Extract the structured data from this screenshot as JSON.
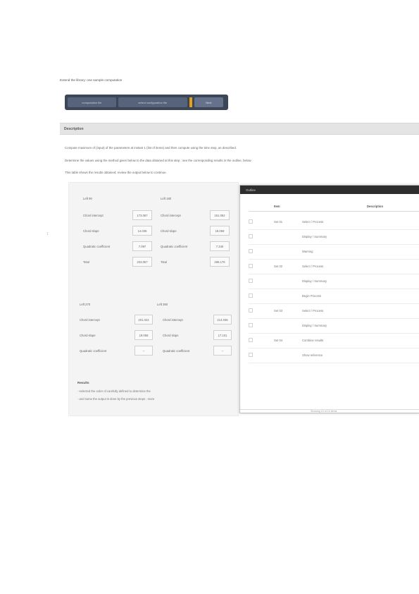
{
  "page": {
    "heading": "Extend the library: one sample computation"
  },
  "tabs": [
    "computation file",
    "select configuration file",
    "Next"
  ],
  "section": {
    "title": "Description",
    "lines": [
      "Compute maximum of (input) of the parameters at instant 1 (list of items) and then compute using the time step, as described.",
      "Determine the values using the method given below to the data obtained at this step ; see the corresponding results in the outline, below.",
      "This table shows the results obtained; review the output below to continue."
    ]
  },
  "table1": {
    "col_a": "Left 90",
    "col_b": "Left 180",
    "rows": [
      {
        "label_a": "Chord intercept",
        "val_a": "173.067",
        "label_b": "Chord intercept",
        "val_b": "151.062"
      },
      {
        "label_a": "Chord slope",
        "val_a": "14.035",
        "label_b": "Chord slope",
        "val_b": "18.059"
      },
      {
        "label_a": "Quadratic coefficient",
        "val_a": "7.097",
        "label_b": "Quadratic coefficient",
        "val_b": "7.340"
      },
      {
        "label_a": "Total",
        "val_a": "203.057",
        "label_b": "Total",
        "val_b": "286.176"
      }
    ]
  },
  "table2": {
    "col_a": "Left 270",
    "col_b": "Left 360",
    "rows": [
      {
        "label_a": "Chord intercept",
        "val_a": "201.022",
        "label_b": "Chord intercept",
        "val_b": "214.036"
      },
      {
        "label_a": "Chord slope",
        "val_a": "19.058",
        "label_b": "Chord slope",
        "val_b": "17.101"
      },
      {
        "label_a": "Quadratic coefficient",
        "val_a": "--",
        "label_b": "Quadratic coefficient",
        "val_b": "--"
      }
    ]
  },
  "notes": {
    "title": "Results",
    "lines": [
      "- selected the order of carefully defined to determine the",
      "- and some the output is done by the previous steps ; more"
    ]
  },
  "dialog": {
    "title": "Outline",
    "col_item": "Item",
    "col_desc": "Description",
    "rows": [
      {
        "item": "Set 01",
        "desc": "Select / Process"
      },
      {
        "item": "",
        "desc": "Display / Summary"
      },
      {
        "item": "",
        "desc": "Warning"
      },
      {
        "item": "Set 02",
        "desc": "Select / Process"
      },
      {
        "item": "",
        "desc": "Display / Summary"
      },
      {
        "item": "",
        "desc": "Begin Process"
      },
      {
        "item": "Set 03",
        "desc": "Select / Process"
      },
      {
        "item": "",
        "desc": "Display / Summary"
      },
      {
        "item": "Set 04",
        "desc": "Combine results"
      },
      {
        "item": "",
        "desc": "Show reference"
      }
    ],
    "footer": "Showing 10 of 10 items"
  }
}
